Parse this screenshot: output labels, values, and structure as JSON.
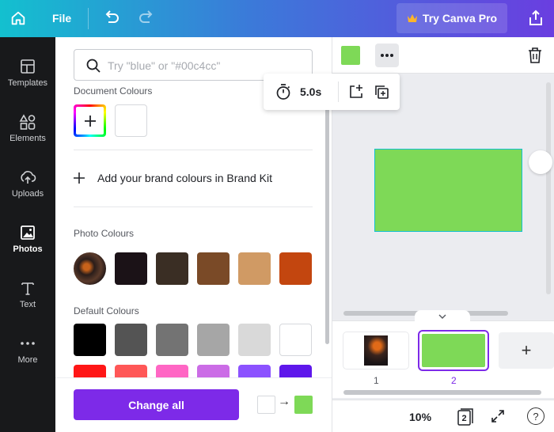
{
  "topbar": {
    "file_label": "File",
    "pro_label": "Try Canva Pro",
    "icons": [
      "home-icon",
      "undo-icon",
      "redo-icon",
      "crown-icon",
      "share-icon"
    ]
  },
  "rail": {
    "items": [
      {
        "label": "Templates",
        "icon": "templates-icon"
      },
      {
        "label": "Elements",
        "icon": "elements-icon"
      },
      {
        "label": "Uploads",
        "icon": "uploads-icon"
      },
      {
        "label": "Photos",
        "icon": "photos-icon"
      },
      {
        "label": "Text",
        "icon": "text-icon"
      },
      {
        "label": "More",
        "icon": "more-icon"
      }
    ],
    "active": "Photos"
  },
  "panel": {
    "search_placeholder": "Try \"blue\" or \"#00c4cc\"",
    "document_colours_title": "Document Colours",
    "document_colours": [
      "#ffffff"
    ],
    "brand_kit_label": "Add your brand colours in Brand Kit",
    "photo_colours_title": "Photo Colours",
    "photo_colours": [
      "#1b1217",
      "#3a2e24",
      "#7a4a27",
      "#d09a64",
      "#c3460f"
    ],
    "default_colours_title": "Default Colours",
    "default_colours_row1": [
      "#000000",
      "#545454",
      "#737373",
      "#a6a6a6",
      "#d9d9d9",
      "#ffffff"
    ],
    "default_colours_row2": [
      "#ff1616",
      "#ff5757",
      "#ff66c4",
      "#cb6ce6",
      "#8c52ff",
      "#5e17eb"
    ],
    "change_all_label": "Change all",
    "replace_from": "#ffffff",
    "replace_to": "#7ed957",
    "arrow": "→"
  },
  "canvas": {
    "selected_color": "#7ed957",
    "accent": "#7d2ae8",
    "selection": "#13c0cf",
    "timer_value": "5.0s",
    "pages": [
      {
        "number": "1"
      },
      {
        "number": "2",
        "active": true
      }
    ],
    "add_page_glyph": "+",
    "zoom": "10%",
    "page_count": "2",
    "help_glyph": "?"
  }
}
